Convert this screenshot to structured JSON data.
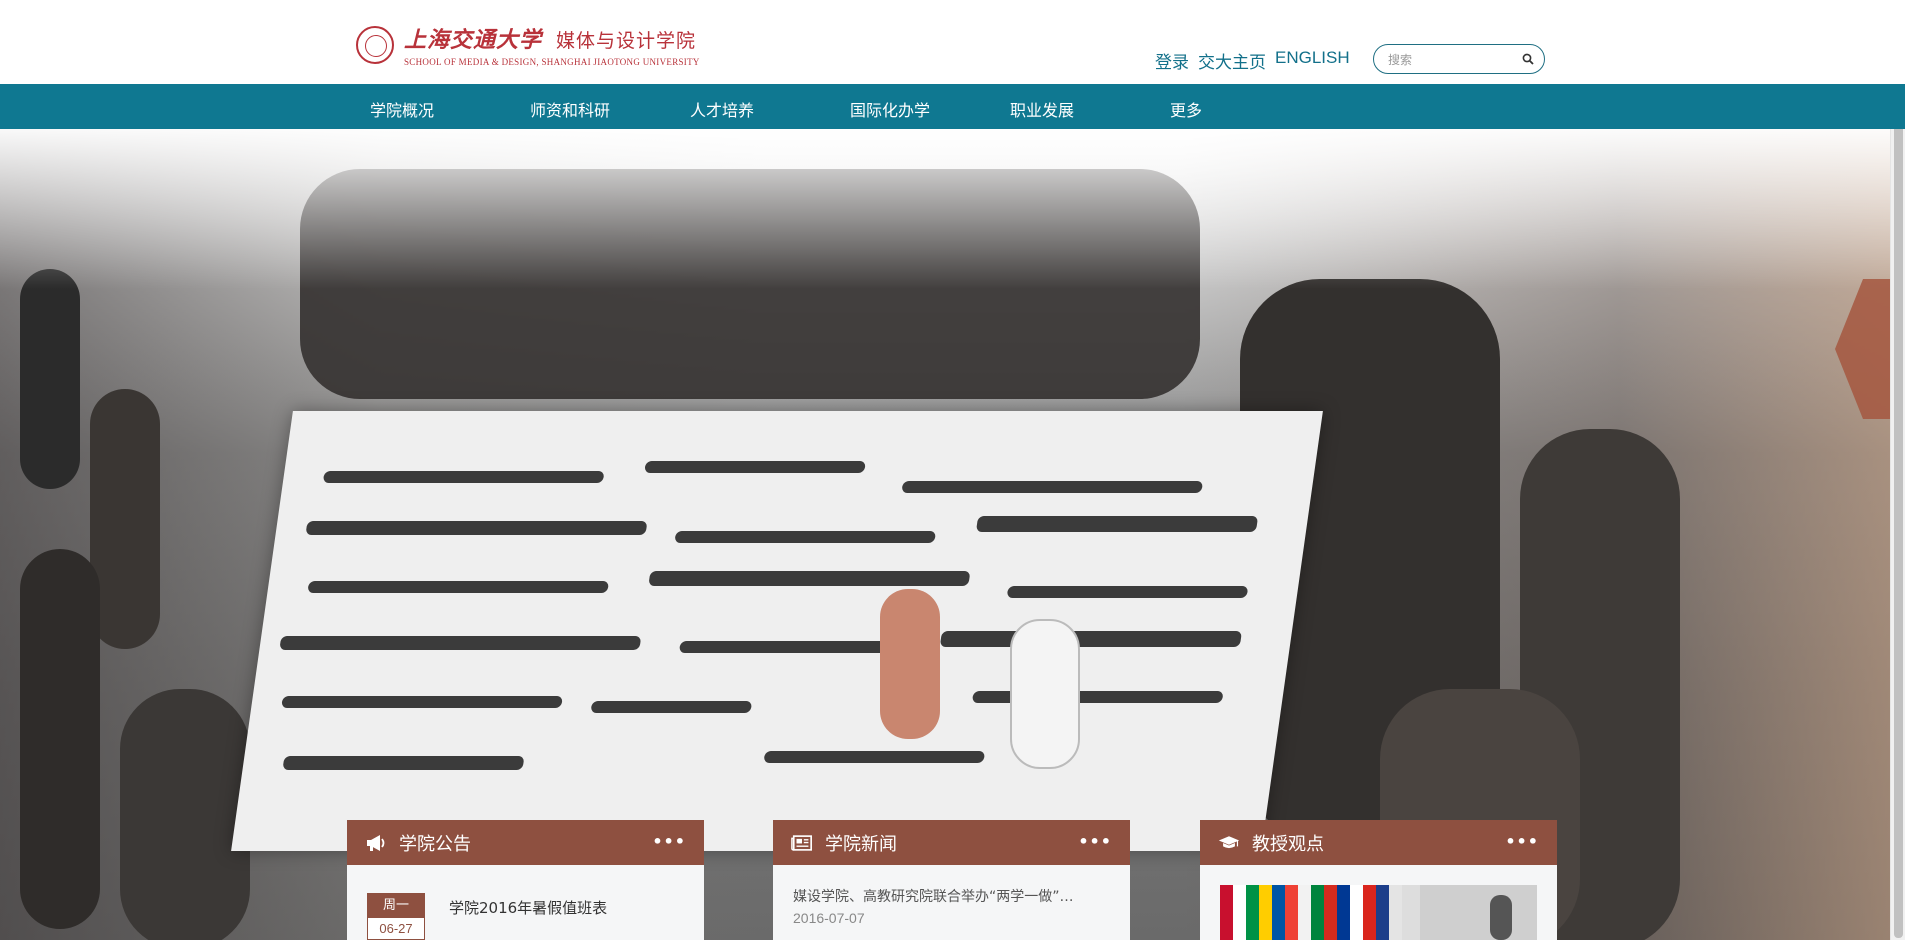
{
  "header": {
    "logo": {
      "cn_university": "上海交通大学",
      "cn_school": "媒体与设计学院",
      "en": "SCHOOL OF MEDIA & DESIGN, SHANGHAI JIAOTONG UNIVERSITY"
    },
    "links": {
      "login": "登录",
      "sjtu_home": "交大主页",
      "english": "ENGLISH"
    },
    "search": {
      "placeholder": "搜索",
      "value": ""
    }
  },
  "nav": {
    "items": [
      "学院概况",
      "师资和科研",
      "人才培养",
      "国际化办学",
      "职业发展",
      "更多"
    ]
  },
  "panels": {
    "announcements": {
      "title": "学院公告",
      "more": "•••",
      "icon": "megaphone-icon",
      "items": [
        {
          "weekday": "周一",
          "date": "06-27",
          "title": "学院2016年暑假值班表"
        }
      ]
    },
    "news": {
      "title": "学院新闻",
      "more": "•••",
      "icon": "newspaper-icon",
      "items": [
        {
          "title": "媒设学院、高教研究院联合举办“两学一做”…",
          "date": "2016-07-07"
        }
      ]
    },
    "views": {
      "title": "教授观点",
      "more": "•••",
      "icon": "graduation-cap-icon"
    }
  },
  "colors": {
    "nav": "#0f7891",
    "accent_links": "#12708a",
    "panel_header": "#8e5040",
    "logo": "#b8323a"
  }
}
